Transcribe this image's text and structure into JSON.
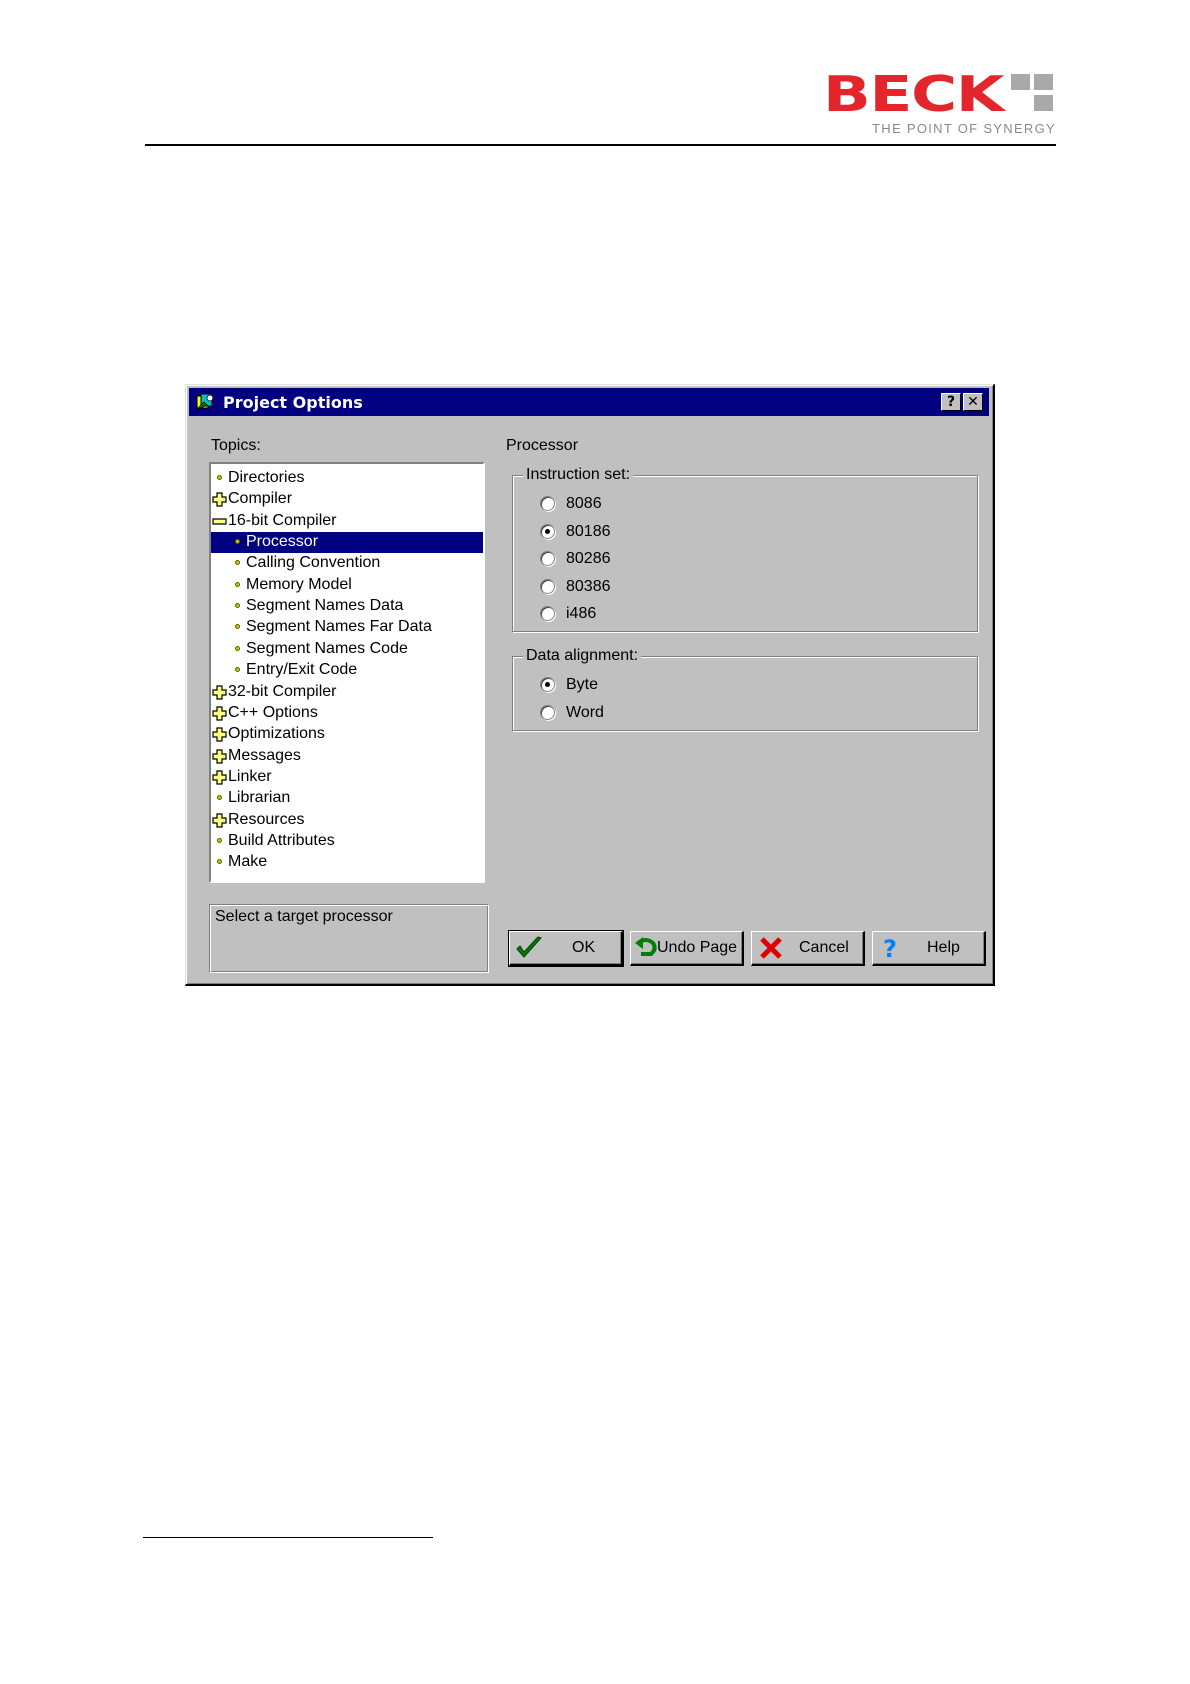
{
  "brand": {
    "name": "BECK",
    "tagline": "THE POINT OF SYNERGY",
    "colors": {
      "primary": "#e3262b",
      "dots": "#a9a9a9"
    }
  },
  "dialog": {
    "title": "Project Options",
    "title_icon": "project-options-icon",
    "help_glyph": "?",
    "close_glyph": "✕",
    "colors": {
      "titlebar": "#000080",
      "face": "#c0c0c0",
      "selection": "#000080"
    }
  },
  "topics": {
    "label": "Topics:",
    "items": [
      {
        "label": "Directories",
        "kind": "leaf",
        "level": 0
      },
      {
        "label": "Compiler",
        "kind": "collapsed",
        "level": 0
      },
      {
        "label": "16-bit Compiler",
        "kind": "expanded",
        "level": 0
      },
      {
        "label": "Processor",
        "kind": "leaf",
        "level": 1,
        "selected": true
      },
      {
        "label": "Calling Convention",
        "kind": "leaf",
        "level": 1
      },
      {
        "label": "Memory Model",
        "kind": "leaf",
        "level": 1
      },
      {
        "label": "Segment Names Data",
        "kind": "leaf",
        "level": 1
      },
      {
        "label": "Segment Names Far Data",
        "kind": "leaf",
        "level": 1
      },
      {
        "label": "Segment Names Code",
        "kind": "leaf",
        "level": 1
      },
      {
        "label": "Entry/Exit Code",
        "kind": "leaf",
        "level": 1
      },
      {
        "label": "32-bit Compiler",
        "kind": "collapsed",
        "level": 0
      },
      {
        "label": "C++ Options",
        "kind": "collapsed",
        "level": 0
      },
      {
        "label": "Optimizations",
        "kind": "collapsed",
        "level": 0
      },
      {
        "label": "Messages",
        "kind": "collapsed",
        "level": 0
      },
      {
        "label": "Linker",
        "kind": "collapsed",
        "level": 0
      },
      {
        "label": "Librarian",
        "kind": "leaf",
        "level": 0
      },
      {
        "label": "Resources",
        "kind": "collapsed",
        "level": 0
      },
      {
        "label": "Build Attributes",
        "kind": "leaf",
        "level": 0
      },
      {
        "label": "Make",
        "kind": "leaf",
        "level": 0
      }
    ]
  },
  "status_text": "Select a target processor",
  "panel": {
    "title": "Processor",
    "instruction_set": {
      "label": "Instruction set:",
      "selected": "80186",
      "options": [
        "8086",
        "80186",
        "80286",
        "80386",
        "i486"
      ]
    },
    "data_alignment": {
      "label": "Data alignment:",
      "selected": "Byte",
      "options": [
        "Byte",
        "Word"
      ]
    }
  },
  "buttons": {
    "ok": "OK",
    "undo": "Undo Page",
    "cancel": "Cancel",
    "help": "Help"
  }
}
